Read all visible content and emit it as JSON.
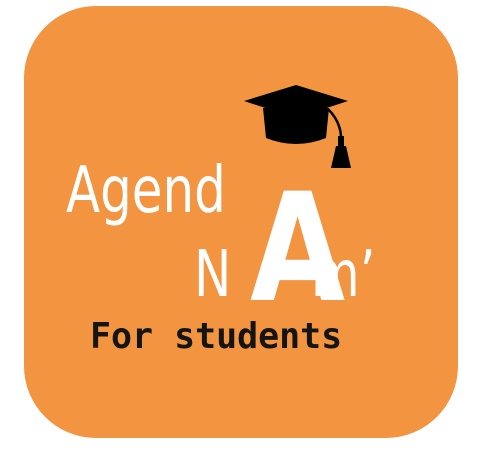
{
  "logo": {
    "word_top": "Agend",
    "big_letter": "A",
    "word_bottom_left": "N",
    "word_bottom_right": "m’",
    "tagline": "For students",
    "icon": "graduation-cap-icon"
  },
  "colors": {
    "tile_background": "#f29440",
    "wordmark": "#ffffff",
    "tagline": "#141414",
    "cap": "#000000",
    "page_background": "#ffffff"
  }
}
